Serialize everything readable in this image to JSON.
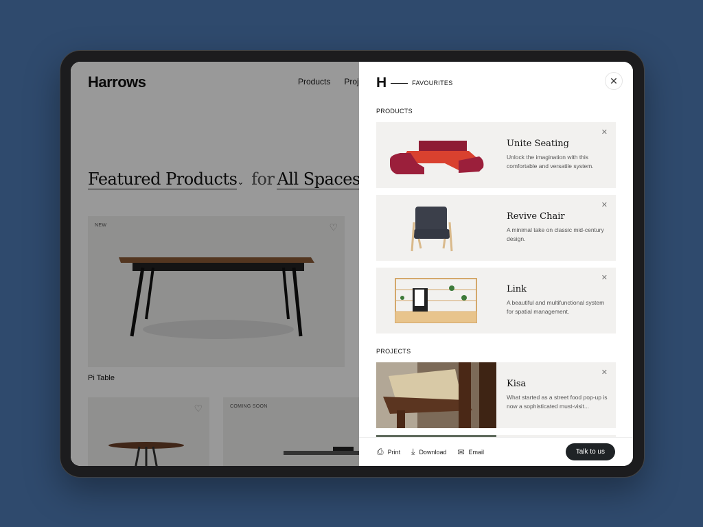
{
  "site": {
    "logo": "Harrows",
    "nav": [
      "Products",
      "Proje"
    ],
    "headline": {
      "category": "Featured Products",
      "chevron": "⌄",
      "connector": "for",
      "space": "All Spaces"
    },
    "cards": [
      {
        "tag": "NEW",
        "caption": "Pi Table"
      },
      {
        "tag": ""
      },
      {
        "tag": "COMING SOON"
      }
    ]
  },
  "panel": {
    "logo": "H",
    "title": "FAVOURITES",
    "close": "✕",
    "products_label": "PRODUCTS",
    "products": [
      {
        "title": "Unite Seating",
        "desc": "Unlock the imagination with this comfortable and versatile system."
      },
      {
        "title": "Revive Chair",
        "desc": "A minimal take on classic mid-century design."
      },
      {
        "title": "Link",
        "desc": "A beautiful and multifunctional system for spatial management."
      }
    ],
    "projects_label": "PROJECTS",
    "projects": [
      {
        "title": "Kisa",
        "desc": "What started as a street food pop-up is now a sophisticated must-visit..."
      }
    ],
    "remove": "✕",
    "footer": {
      "print": "Print",
      "download": "Download",
      "email": "Email",
      "cta": "Talk to us"
    }
  },
  "colors": {
    "background": "#2f4a6d",
    "cta": "#1f2326",
    "card": "#f2f1ef"
  }
}
